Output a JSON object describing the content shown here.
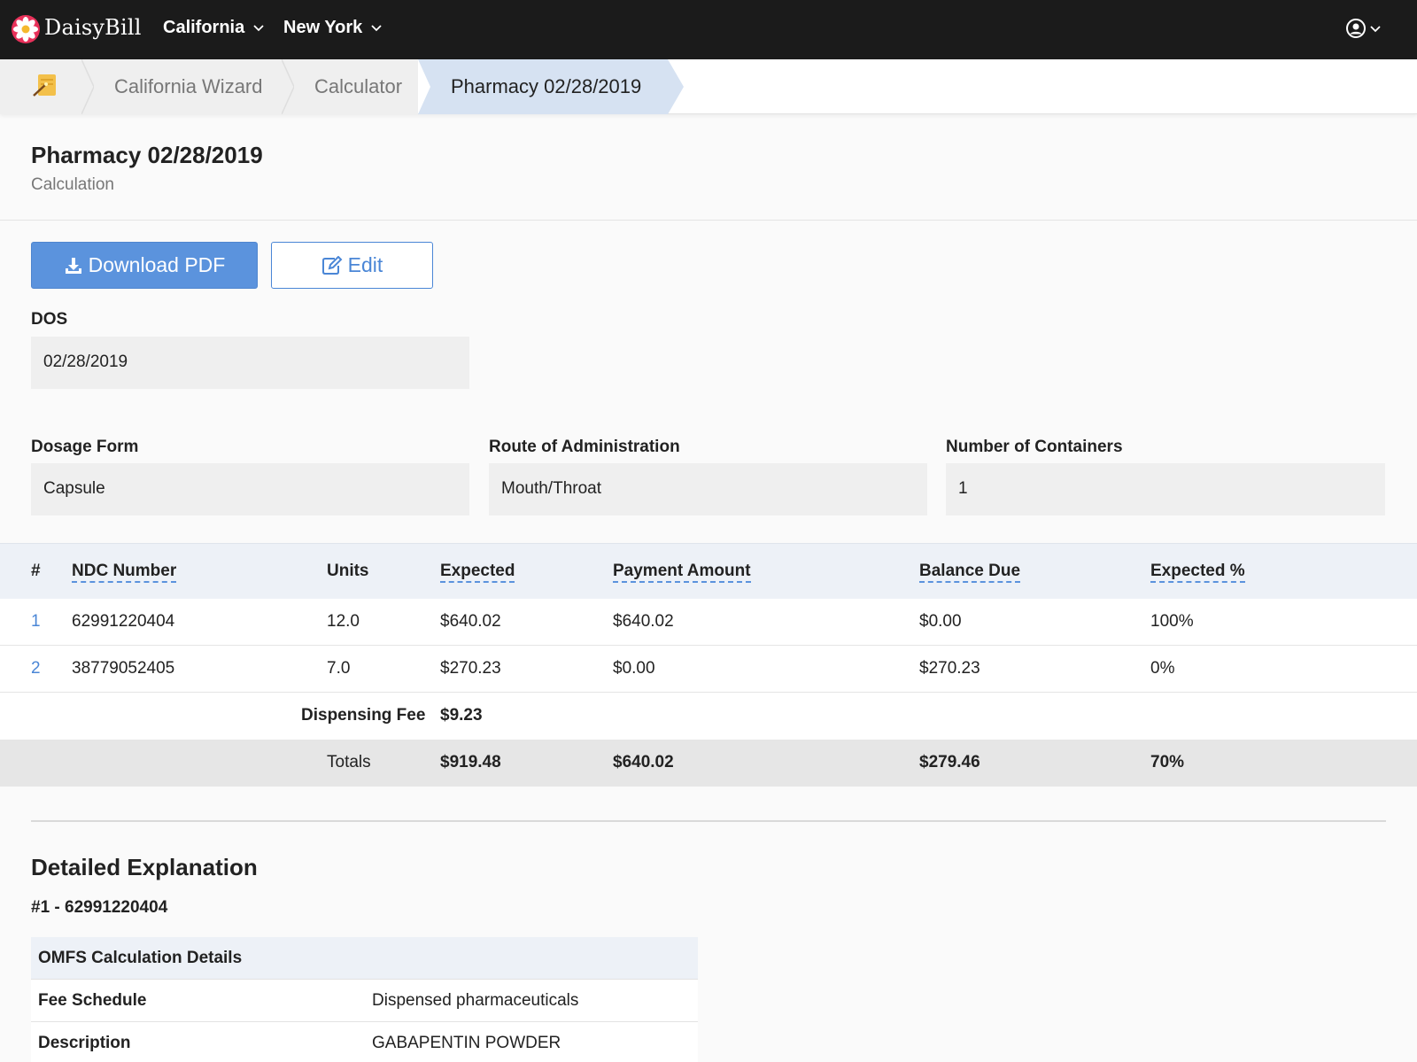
{
  "topnav": {
    "brand": "DaisyBill",
    "items": [
      {
        "label": "California"
      },
      {
        "label": "New York"
      }
    ]
  },
  "breadcrumb": {
    "items": [
      {
        "label": "California Wizard"
      },
      {
        "label": "Calculator"
      },
      {
        "label": "Pharmacy 02/28/2019"
      }
    ]
  },
  "page": {
    "title": "Pharmacy 02/28/2019",
    "subtitle": "Calculation"
  },
  "actions": {
    "download_label": "Download PDF",
    "edit_label": "Edit"
  },
  "fields": {
    "dos": {
      "label": "DOS",
      "value": "02/28/2019"
    },
    "dosage_form": {
      "label": "Dosage Form",
      "value": "Capsule"
    },
    "route": {
      "label": "Route of Administration",
      "value": "Mouth/Throat"
    },
    "containers": {
      "label": "Number of Containers",
      "value": "1"
    }
  },
  "table": {
    "headers": {
      "num": "#",
      "ndc": "NDC Number",
      "units": "Units",
      "expected": "Expected",
      "payment": "Payment Amount",
      "balance": "Balance Due",
      "expected_pct": "Expected %"
    },
    "rows": [
      {
        "num": "1",
        "ndc": "62991220404",
        "units": "12.0",
        "expected": "$640.02",
        "payment": "$640.02",
        "balance": "$0.00",
        "pct": "100%"
      },
      {
        "num": "2",
        "ndc": "38779052405",
        "units": "7.0",
        "expected": "$270.23",
        "payment": "$0.00",
        "balance": "$270.23",
        "pct": "0%"
      }
    ],
    "dispensing_fee": {
      "label": "Dispensing Fee",
      "value": "$9.23"
    },
    "totals": {
      "label": "Totals",
      "expected": "$919.48",
      "payment": "$640.02",
      "balance": "$279.46",
      "pct": "70%"
    }
  },
  "explanation": {
    "title": "Detailed Explanation",
    "item_heading": "#1 - 62991220404",
    "table_header": "OMFS Calculation Details",
    "rows": [
      {
        "key": "Fee Schedule",
        "value": "Dispensed pharmaceuticals"
      },
      {
        "key": "Description",
        "value": "GABAPENTIN POWDER"
      }
    ]
  },
  "colors": {
    "nav_bg": "#1b1b1b",
    "primary": "#5b93dd",
    "link": "#4a86d6",
    "active_crumb": "#d6e2f2"
  }
}
